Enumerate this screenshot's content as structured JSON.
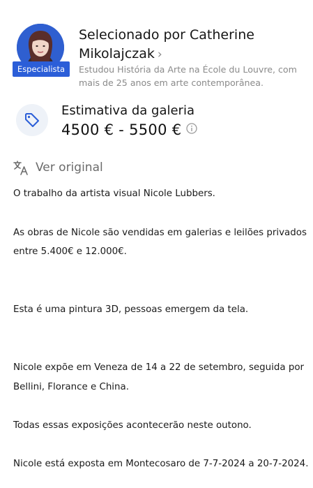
{
  "expert": {
    "badge": "Especialista",
    "name_line1": "Selecionado por Catherine",
    "name_line2": "Mikolajczak",
    "bio": "Estudou História da Arte na École du Louvre, com mais de 25 anos em arte contemporânea."
  },
  "estimate": {
    "label": "Estimativa da galeria",
    "range": "4500 € - 5500 €"
  },
  "translate": {
    "label": "Ver original"
  },
  "description": [
    "O trabalho da artista visual Nicole Lubbers.",
    "As obras de Nicole são vendidas em galerias e leilões privados",
    "entre 5.400€ e 12.000€.",
    "Esta é uma pintura 3D, pessoas emergem da tela.",
    "Nicole expõe em Veneza de 14 a 22 de setembro, seguida por",
    "Bellini, Florance e China.",
    "Todas essas exposições acontecerão neste outono.",
    "Nicole está exposta em Montecosaro de 7-7-2024 a 20-7-2024."
  ],
  "colors": {
    "accent": "#2b5ed8",
    "muted_text": "#8a8a8a",
    "icon_bg": "#eef2f8"
  },
  "icons": [
    "avatar-photo",
    "chevron-right-icon",
    "price-tag-icon",
    "info-icon",
    "translate-icon"
  ]
}
